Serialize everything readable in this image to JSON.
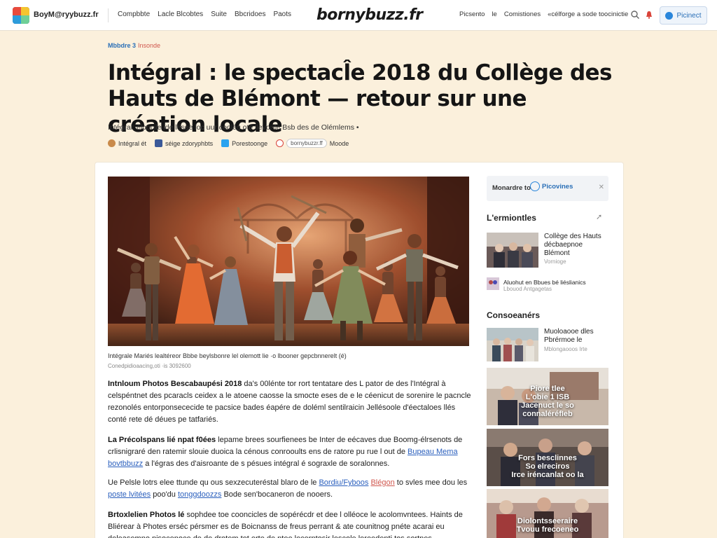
{
  "header": {
    "site_small": "BoyM@ryybuzz.fr",
    "nav": [
      "Compbbte",
      "Lacle Blcobtes",
      "Suite",
      "Bbcridoes",
      "Paots"
    ],
    "brand": "bornybuzz.fr",
    "util": [
      "Picsento",
      "le",
      "Comistiones",
      "«célforge a sode toocinictie"
    ],
    "cta_label": "Picinect"
  },
  "article": {
    "crumb_main": "Mbbdre 3",
    "crumb_sec": "Insonde",
    "title": "Intégral : le spectacl̂e 2018 du Collège des Hauts de Blémont — retour sur une création locale",
    "lede": "Intégral: élpocile ide lésge loc uur coolég ote llevonte Bsb des de Olémlems •",
    "share": [
      {
        "icon": "avatar-icon",
        "label": "Intégral ét"
      },
      {
        "icon": "facebook-icon",
        "label": "séige zdoryphbts"
      },
      {
        "icon": "twitter-icon",
        "label": "Porestoonge"
      },
      {
        "icon": "link-icon",
        "label": "bornybuzzr.ff",
        "extra": "Moode"
      }
    ],
    "caption": "Intégrale  Mariés lealtéreor Bbbe beylsbonre lel olemott lie ·o lbooner gepcbnnerelt (é)",
    "credit": "Conedpidioaacing,oti ·is 3092600",
    "p1_lead": "Intnloum Photos Bescabaupési 2018",
    "p1_text": "da's 00lénte tor rort tentatare des L pator de des l'Intégral à celspéntnet des pcaracls ceidex a le atoene caosse la smocte eses de e le céenicut de sorenire le pacncle rezonolés entorponsececide te pacsice bades éapére de doléml sentilraicin Jellésoole d'éectaloes llés conté rete dé déues pe tatfariés.",
    "p2_lead": "La Précolspans lié npat f0ées",
    "p2_text": "lepame brees sourfienees be Inter de eécaves due Boomg-élrsenots de crlisnigraré den ratemir slouie duoica la cénous conrooults ens de ratore pu rue l out de",
    "p2_link1": "Bupeau Mema",
    "p2_link2": "bovtbbuzz",
    "p2_text2": "a l'égras des d'aisroante de s pésues intégral é sograxle de soralonnes.",
    "p3_text": "Ue Pelsle lotrs elee ttunde qu ous sexzecuteréstal blaro de le",
    "p3_link1": "Bordiu/Fyboos",
    "p3_link2": "Blégon",
    "p3_text2": "to svles mee dou les",
    "p3_link3": "poste lvitées",
    "p3_text3": "poo'du",
    "p3_link4": "tonggdoozzs",
    "p3_text4": "Bode sen'bocaneron de nooers.",
    "p4_lead": "Brtoxlelien Photos lé",
    "p4_text": "sophdee toe cooncicles de sopérécdr et dee l olléoce le acolomvntees. Haints de Bliérear à Photes erséc pérsmer es de Boicnanss de freus perrant & ate counitnog pnéte acarai eu deleasemno pisocenoce de de drotem tet erte de ntee lecerntosir lescole lereedenti tos sortnes."
  },
  "sidebar": {
    "box_label": "Monardre to",
    "box_option": "Picovines",
    "section1": "L'ermiontles",
    "item1_title": "Collège des Hauts décbaepnoe Blémont",
    "item1_meta": "Vornioge",
    "item2_title": "Aluohut en Bbues bé liéslianics",
    "item2_meta": "Lbouod Antgagetas",
    "section2": "Consoeanérs",
    "item3_title": "Muoloaooe dles Pbrérmoe le",
    "item3_meta": "Mblongaooos Irte",
    "photo1_text": "Piore tlee\nL'obie 1 ISB\nJacenuct le so\nconnaléréfIeb",
    "photo2_text": "Fors besclinnes\nSo elreciros\nIrce iréncanlat oo la",
    "photo3_text": "Diolontsseeraire\nTvouu frecoeneo"
  }
}
